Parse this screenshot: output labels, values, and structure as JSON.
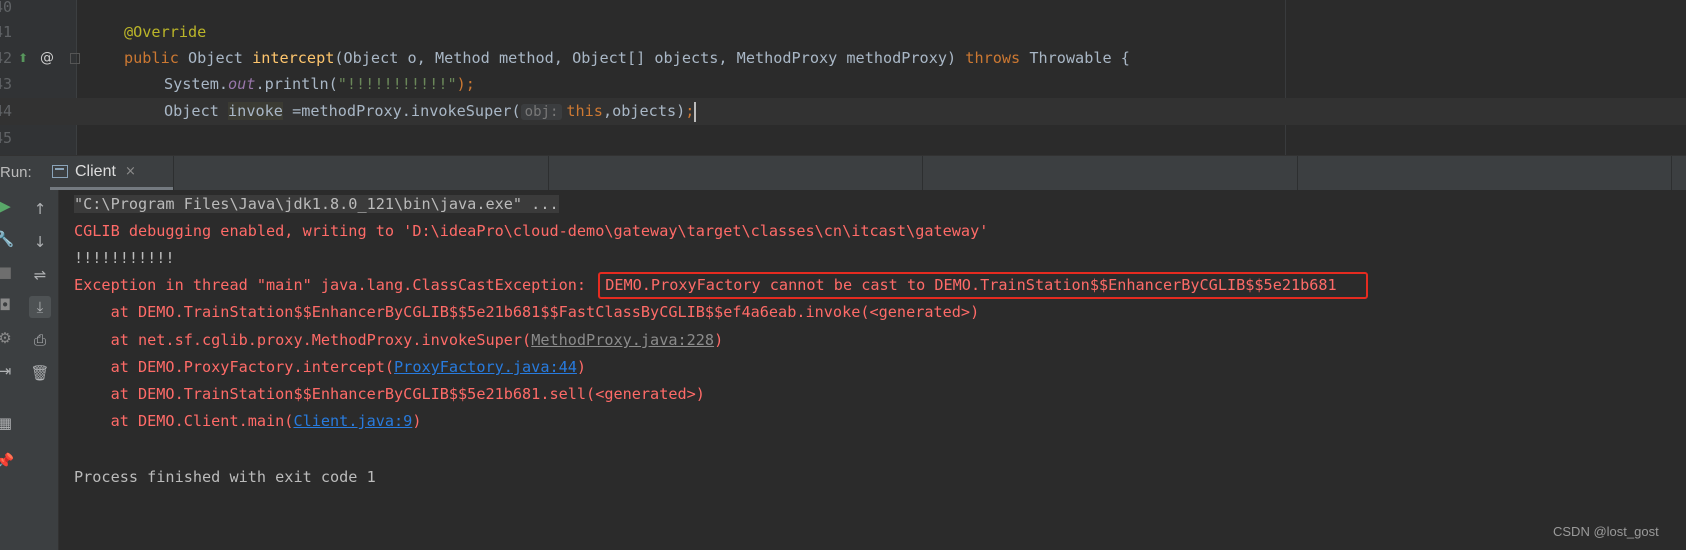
{
  "editor": {
    "line_numbers": [
      "40",
      "41",
      "42",
      "43",
      "44",
      "45"
    ],
    "annotation": "@Override",
    "sig_public": "public",
    "sig_object": "Object",
    "sig_method": "intercept",
    "sig_params": "(Object o, Method method, Object[] objects, MethodProxy methodProxy)",
    "sig_throws": "throws",
    "sig_tail": "Throwable {",
    "println_pre": "System.",
    "println_field": "out",
    "println_mid": ".println(",
    "println_str": "\"!!!!!!!!!!!\"",
    "println_end": ");",
    "invoke_type": "Object",
    "invoke_var": "invoke",
    "invoke_call": "=methodProxy.invokeSuper(",
    "invoke_hint": "obj:",
    "invoke_this": "this",
    "invoke_args": ",objects)",
    "invoke_end": ";",
    "gutter_icon_override": "⬆",
    "gutter_icon_at": "@"
  },
  "run": {
    "label": "Run:",
    "tab_label": "Client",
    "tab_close": "×"
  },
  "toolbar": {
    "icons": [
      "run-icon",
      "wrench-icon",
      "stop-icon",
      "camera-icon",
      "settings-icon",
      "login-icon",
      "layout-icon",
      "pin-icon",
      "up-arrow-icon",
      "down-arrow-icon",
      "soft-wrap-icon",
      "scroll-to-end-icon",
      "print-icon",
      "trash-icon"
    ]
  },
  "console": {
    "cmd": "\"C:\\Program Files\\Java\\jdk1.8.0_121\\bin\\java.exe\" ...",
    "cglib_line": "CGLIB debugging enabled, writing to 'D:\\ideaPro\\cloud-demo\\gateway\\target\\classes\\cn\\itcast\\gateway'",
    "bangs": "!!!!!!!!!!!",
    "exception_prefix": "Exception in thread \"main\" java.lang.ClassCastException: ",
    "exception_msg": "DEMO.ProxyFactory cannot be cast to DEMO.TrainStation$$EnhancerByCGLIB$$5e21b681",
    "st1": "    at DEMO.TrainStation$$EnhancerByCGLIB$$5e21b681$$FastClassByCGLIB$$ef4a6eab.invoke(<generated>)",
    "st2_pre": "    at net.sf.cglib.proxy.MethodProxy.invokeSuper(",
    "st2_link": "MethodProxy.java:228",
    "st2_post": ")",
    "st3_pre": "    at DEMO.ProxyFactory.intercept(",
    "st3_link": "ProxyFactory.java:44",
    "st3_post": ")",
    "st4": "    at DEMO.TrainStation$$EnhancerByCGLIB$$5e21b681.sell(<generated>)",
    "st5_pre": "    at DEMO.Client.main(",
    "st5_link": "Client.java:9",
    "st5_post": ")",
    "finished": "Process finished with exit code 1"
  },
  "watermark": "CSDN @lost_gost"
}
